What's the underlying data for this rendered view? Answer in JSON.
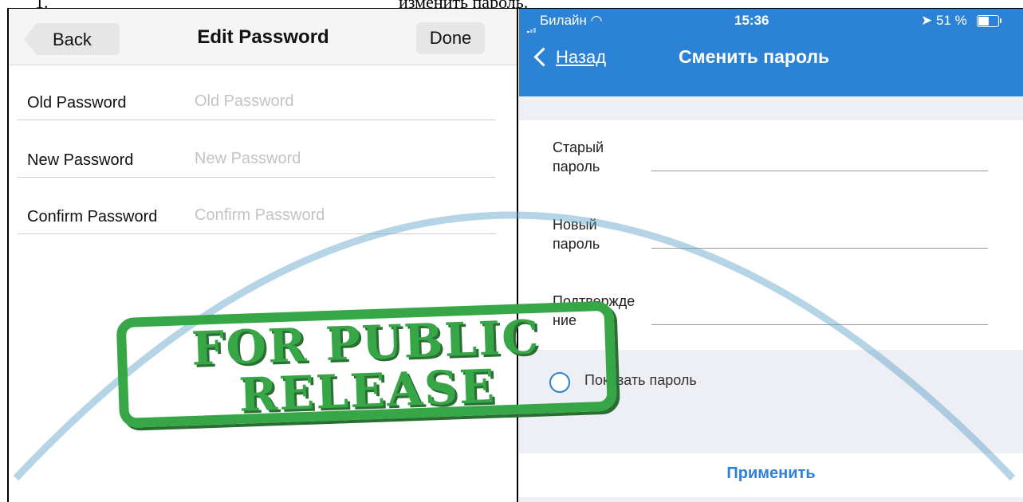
{
  "caption": {
    "number": "1.",
    "text": "изменить пароль."
  },
  "left": {
    "back_label": "Back",
    "title": "Edit Password",
    "done_label": "Done",
    "fields": [
      {
        "label": "Old Password",
        "placeholder": "Old Password"
      },
      {
        "label": "New Password",
        "placeholder": "New Password"
      },
      {
        "label": "Confirm Password",
        "placeholder": "Confirm Password"
      }
    ]
  },
  "right": {
    "status": {
      "carrier": "Билайн",
      "time": "15:36",
      "battery": "51 %"
    },
    "back_label": "Назад",
    "title": "Сменить пароль",
    "fields": [
      {
        "label": "Старый пароль"
      },
      {
        "label": "Новый пароль"
      },
      {
        "label": "Подтверждение"
      }
    ],
    "show_password_label": "Показать пароль",
    "apply_label": "Применить",
    "accent_color": "#2c82d5"
  },
  "watermark": {
    "line1": "FOR PUBLIC",
    "line2": "RELEASE",
    "color": "#37a647"
  }
}
